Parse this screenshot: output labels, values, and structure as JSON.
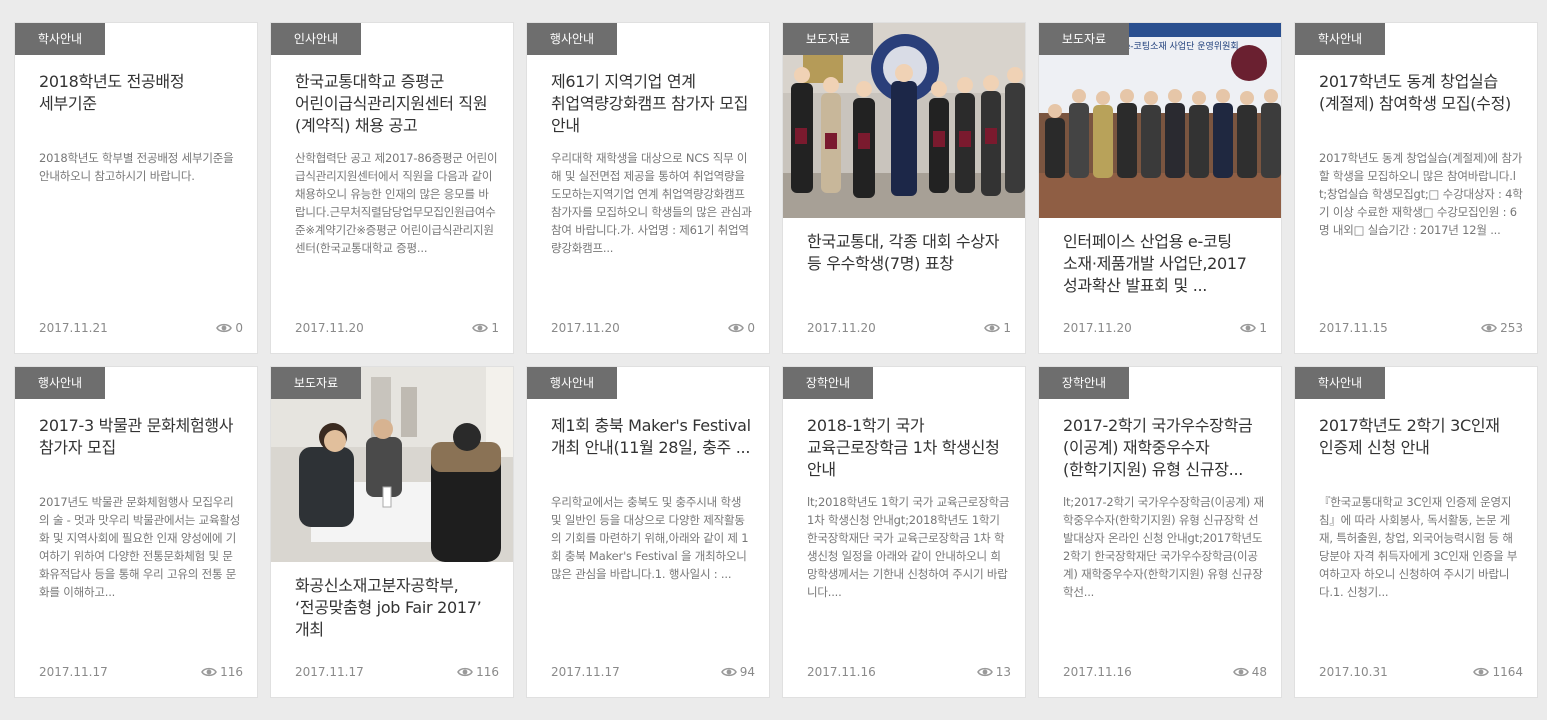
{
  "cards": [
    {
      "category": "학사안내",
      "title": "2018학년도 전공배정 세부기준",
      "excerpt": "2018학년도 학부별 전공배정 세부기준을안내하오니 참고하시기 바랍니다.",
      "date": "2017.11.21",
      "views": "0"
    },
    {
      "category": "인사안내",
      "title": "한국교통대학교 증평군 어린이급식관리지원센터 직원(계약직) 채용 공고",
      "excerpt": "산학협력단 공고 제2017-86증평군 어린이급식관리지원센터에서 직원을 다음과 같이 채용하오니 유능한 인재의 많은 응모를 바랍니다.근무처직렬담당업무모집인원급여수준※계약기간※증평군 어린이급식관리지원센터(한국교통대학교 증평...",
      "date": "2017.11.20",
      "views": "1"
    },
    {
      "category": "행사안내",
      "title": "제61기 지역기업 연계 취업역량강화캠프 참가자 모집 안내",
      "excerpt": "우리대학 재학생을 대상으로 NCS 직무 이해 및 실전면접 제공을 통하여 취업역량을 도모하는지역기업 연계 취업역량강화캠프 참가자를 모집하오니 학생들의 많은 관심과 참여 바랍니다.가. 사업명 : 제61기 취업역량강화캠프...",
      "date": "2017.11.20",
      "views": "0"
    },
    {
      "category": "보도자료",
      "title": "한국교통대, 각종 대회 수상자 등 우수학생(7명) 표창",
      "excerpt": "",
      "date": "2017.11.20",
      "views": "1",
      "image_alt": "award-ceremony-photo"
    },
    {
      "category": "보도자료",
      "title": "인터페이스 산업용 e-코팅 소재·제품개발 사업단,2017 성과확산 발표회 및 ...",
      "excerpt": "",
      "date": "2017.11.20",
      "views": "1",
      "image_alt": "group-photo-stage"
    },
    {
      "category": "학사안내",
      "title": "2017학년도 동계 창업실습(계절제) 참여학생 모집(수정)",
      "excerpt": "2017학년도 동계 창업실습(계절제)에 참가할 학생을 모집하오니 많은 참여바랍니다.lt;창업실습 학생모집gt;□ 수강대상자 : 4학기 이상 수료한 재학생□ 수강모집인원 : 6명 내외□ 실습기간 : 2017년 12월 ...",
      "date": "2017.11.15",
      "views": "253"
    },
    {
      "category": "행사안내",
      "title": "2017-3 박물관 문화체험행사 참가자 모집",
      "excerpt": "2017년도 박물관 문화체험행사 모집우리의 술 - 멋과 맛우리 박물관에서는 교육활성화 및 지역사회에 필요한 인재 양성에에 기여하기 위하여 다양한 전통문화체험 및 문화유적답사 등을 통해 우리 고유의 전통 문화를 이해하고...",
      "date": "2017.11.17",
      "views": "116"
    },
    {
      "category": "보도자료",
      "title": "화공신소재고분자공학부, ‘전공맞춤형 job Fair 2017’ 개최",
      "excerpt": "",
      "date": "2017.11.17",
      "views": "116",
      "image_alt": "job-fair-photo"
    },
    {
      "category": "행사안내",
      "title": "제1회 충북 Maker's Festival 개최 안내(11월 28일, 충주 ...",
      "excerpt": "우리학교에서는 충북도 및 충주시내 학생 및 일반인 등을 대상으로 다양한 제작활동의 기회를 마련하기 위해,아래와 같이 제 1회 충북 Maker's Festival 을 개최하오니 많은 관심을 바랍니다.1. 행사일시 : ...",
      "date": "2017.11.17",
      "views": "94"
    },
    {
      "category": "장학안내",
      "title": "2018-1학기 국가 교육근로장학금 1차 학생신청 안내",
      "excerpt": "lt;2018학년도 1학기 국가 교육근로장학금 1차 학생신청 안내gt;2018학년도 1학기 한국장학재단 국가 교육근로장학금 1차 학생신청 일정을 아래와 같이 안내하오니 희망학생께서는 기한내 신청하여 주시기 바랍니다....",
      "date": "2017.11.16",
      "views": "13"
    },
    {
      "category": "장학안내",
      "title": "2017-2학기 국가우수장학금(이공계) 재학중우수자(한학기지원) 유형 신규장...",
      "excerpt": "lt;2017-2학기 국가우수장학금(이공계) 재학중우수자(한학기지원) 유형 신규장학 선발대상자 온라인 신청 안내gt;2017학년도 2학기 한국장학재단 국가우수장학금(이공계) 재학중우수자(한학기지원) 유형 신규장학선...",
      "date": "2017.11.16",
      "views": "48"
    },
    {
      "category": "학사안내",
      "title": "2017학년도 2학기 3C인재 인증제 신청 안내",
      "excerpt": "『한국교통대학교 3C인재 인증제 운영지침』에 따라 사회봉사, 독서활동, 논문 게재, 특허출원, 창업, 외국어능력시험 등 해당분야 자격 취득자에게 3C인재 인증을 부여하고자 하오니 신청하여 주시기 바랍니다.1. 신청기...",
      "date": "2017.10.31",
      "views": "1164"
    }
  ],
  "colors": {
    "background": "#ebebeb",
    "badge": "#6e6e6e",
    "title": "#333333",
    "excerpt": "#777777",
    "meta": "#8a8a8a"
  }
}
